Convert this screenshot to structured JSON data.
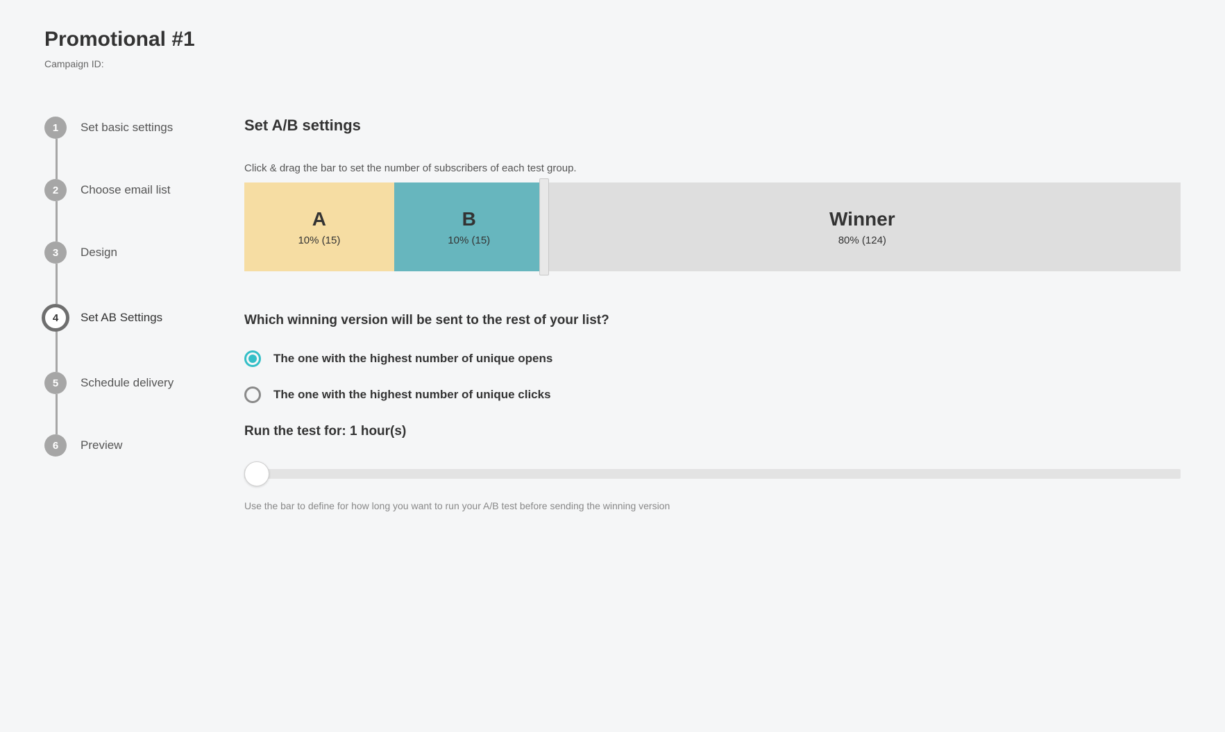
{
  "header": {
    "title": "Promotional #1",
    "campaign_id_label": "Campaign ID:"
  },
  "stepper": {
    "active_index": 3,
    "steps": [
      {
        "num": "1",
        "label": "Set basic settings"
      },
      {
        "num": "2",
        "label": "Choose email list"
      },
      {
        "num": "3",
        "label": "Design"
      },
      {
        "num": "4",
        "label": "Set AB Settings"
      },
      {
        "num": "5",
        "label": "Schedule delivery"
      },
      {
        "num": "6",
        "label": "Preview"
      }
    ]
  },
  "ab": {
    "title": "Set A/B settings",
    "instruction": "Click & drag the bar to set the number of subscribers of each test group.",
    "segments": {
      "a": {
        "title": "A",
        "sub": "10% (15)",
        "width_pct": 16
      },
      "b": {
        "title": "B",
        "sub": "10% (15)",
        "width_pct": 16
      },
      "winner": {
        "title": "Winner",
        "sub": "80% (124)",
        "width_pct": 68
      }
    }
  },
  "winner_criteria": {
    "question": "Which winning version will be sent to the rest of your list?",
    "selected_index": 0,
    "options": [
      "The one with the highest number of unique opens",
      "The one with the highest number of unique clicks"
    ]
  },
  "duration": {
    "label_prefix": "Run the test for: ",
    "value": "1 hour(s)",
    "helper": "Use the bar to define for how long you want to run your A/B test before sending the winning version"
  }
}
